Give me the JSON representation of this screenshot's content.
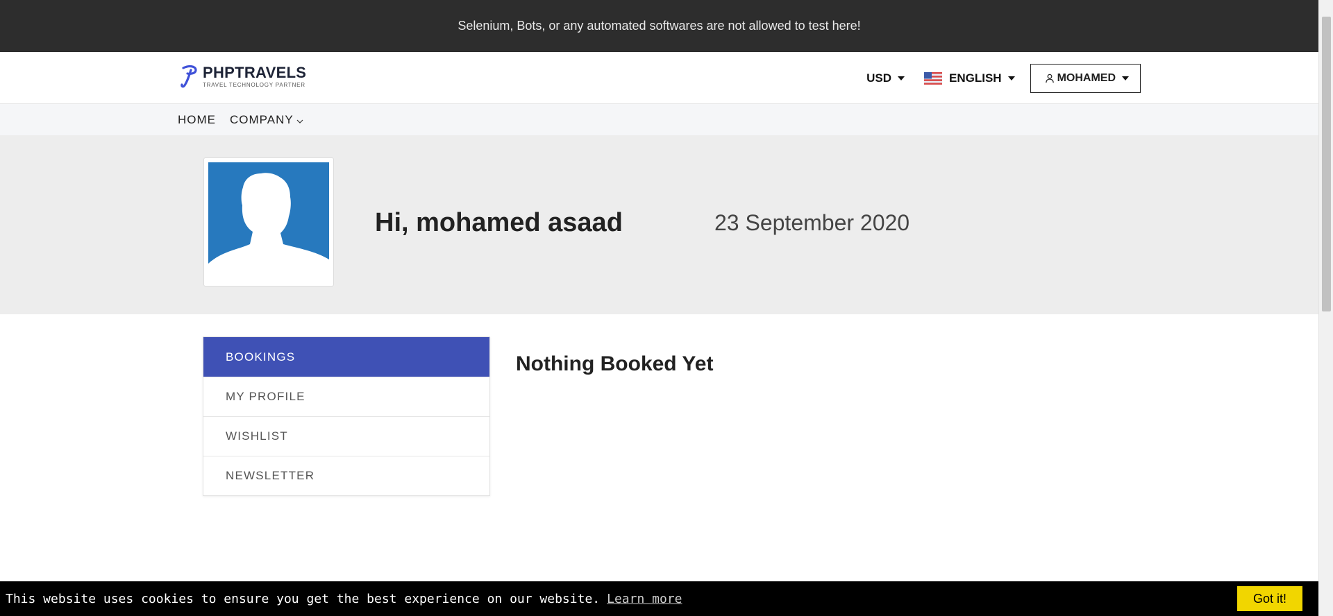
{
  "topbar": {
    "message": "Selenium, Bots, or any automated softwares are not allowed to test here!"
  },
  "header": {
    "logo_name": "PHPTRAVELS",
    "logo_tagline": "TRAVEL TECHNOLOGY PARTNER",
    "currency": "USD",
    "language": "ENGLISH",
    "user": "MOHAMED"
  },
  "nav": {
    "items": [
      {
        "label": "HOME"
      },
      {
        "label": "COMPANY"
      }
    ]
  },
  "hero": {
    "greeting": "Hi, mohamed asaad",
    "date": "23 September 2020"
  },
  "sidebar": {
    "items": [
      {
        "label": "BOOKINGS"
      },
      {
        "label": "MY PROFILE"
      },
      {
        "label": "WISHLIST"
      },
      {
        "label": "NEWSLETTER"
      }
    ]
  },
  "main": {
    "empty_message": "Nothing Booked Yet"
  },
  "cookie": {
    "message": "This website uses cookies to ensure you get the best experience on our website.",
    "learn_more": "Learn more",
    "accept": "Got it!"
  },
  "colors": {
    "accent": "#3f51b5",
    "topbar_bg": "#2d2d2d",
    "hero_bg": "#ededed",
    "cookie_button": "#f1d600",
    "avatar_bg": "#2779be"
  }
}
